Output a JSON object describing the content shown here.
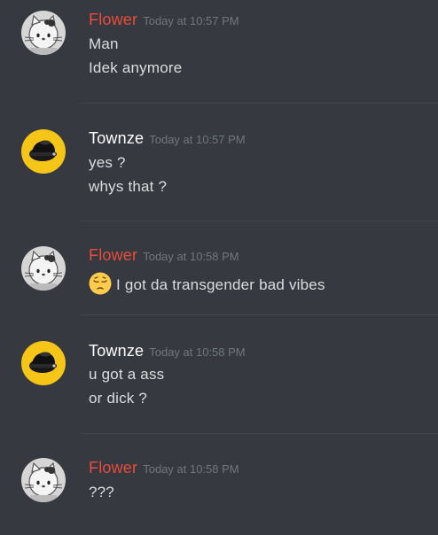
{
  "colors": {
    "background": "#36393f",
    "flower_name": "#e74c3c",
    "townze_name": "#ffffff",
    "timestamp": "#72767d",
    "message_text": "#dcddde",
    "divider": "#42454a"
  },
  "messages": [
    {
      "author": "Flower",
      "avatar_icon": "hello-kitty-avatar-icon",
      "timestamp": "Today at 10:57 PM",
      "lines": [
        "Man",
        "Idek anymore"
      ]
    },
    {
      "author": "Townze",
      "avatar_icon": "black-hat-avatar-icon",
      "timestamp": "Today at 10:57 PM",
      "lines": [
        "yes ?",
        "whys that ?"
      ]
    },
    {
      "author": "Flower",
      "avatar_icon": "hello-kitty-avatar-icon",
      "timestamp": "Today at 10:58 PM",
      "emoji": "pensive-face-emoji",
      "lines": [
        "I got da transgender bad vibes"
      ]
    },
    {
      "author": "Townze",
      "avatar_icon": "black-hat-avatar-icon",
      "timestamp": "Today at 10:58 PM",
      "lines": [
        "u got a ass",
        "or dick ?"
      ]
    },
    {
      "author": "Flower",
      "avatar_icon": "hello-kitty-avatar-icon",
      "timestamp": "Today at 10:58 PM",
      "lines": [
        "???"
      ]
    }
  ]
}
